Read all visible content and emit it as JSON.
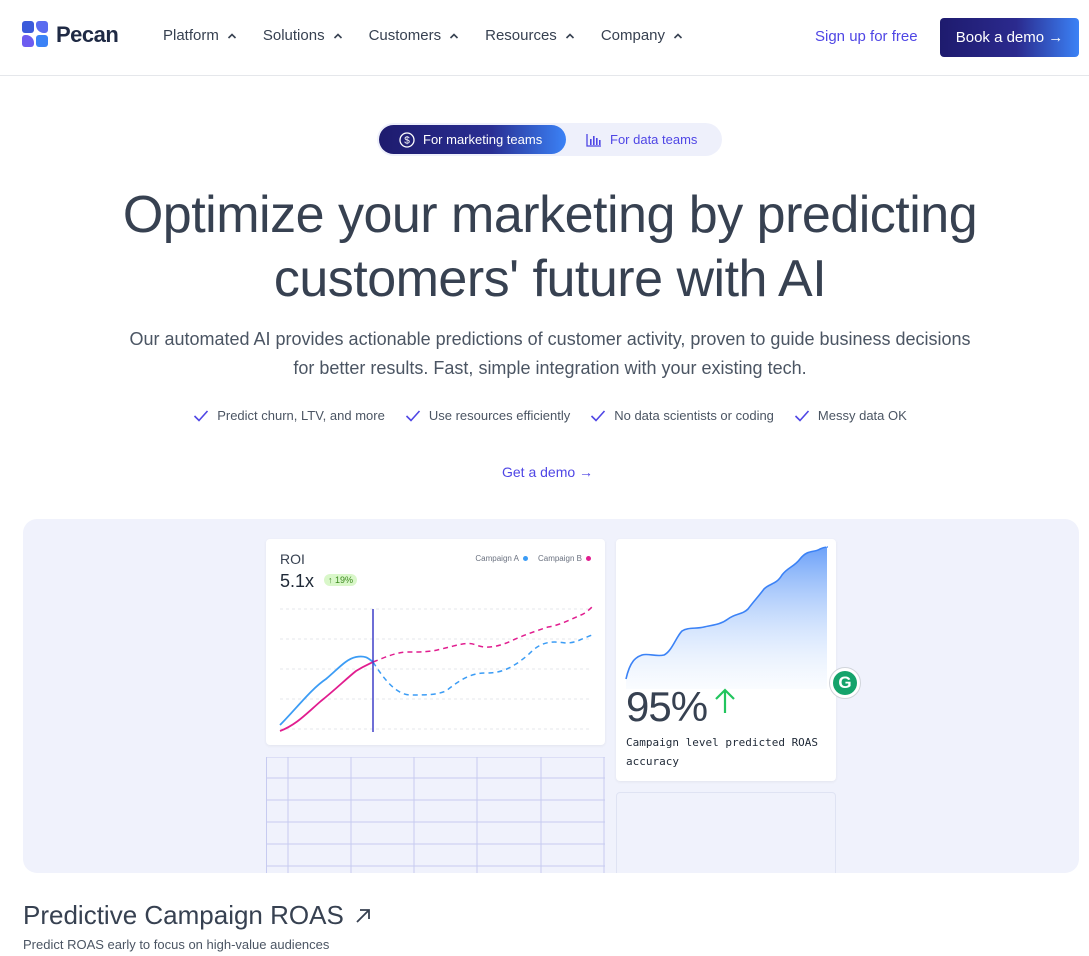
{
  "brand": {
    "name": "Pecan",
    "colors": {
      "accent": "#4f46e5",
      "navy": "#1e1b6e",
      "blue": "#3b82f6",
      "pink": "#e11d8f",
      "green": "#22c55e"
    }
  },
  "nav": {
    "menu": [
      {
        "label": "Platform",
        "icon": "chevron-up-icon"
      },
      {
        "label": "Solutions",
        "icon": "chevron-up-icon"
      },
      {
        "label": "Customers",
        "icon": "chevron-up-icon"
      },
      {
        "label": "Resources",
        "icon": "chevron-up-icon"
      },
      {
        "label": "Company",
        "icon": "chevron-up-icon"
      }
    ],
    "signup": "Sign up for free",
    "book_demo": "Book a demo →"
  },
  "toggle": {
    "active": "For marketing teams",
    "active_icon": "dollar-circle-icon",
    "inactive": "For data teams",
    "inactive_icon": "bar-chart-icon"
  },
  "hero": {
    "title_line1": "Optimize your marketing by predicting",
    "title_line2": "customers' future with AI",
    "subtitle_line1": "Our automated AI provides actionable predictions of customer activity, proven to guide business decisions",
    "subtitle_line2": "for better results. Fast, simple integration with your existing tech.",
    "checks": [
      "Predict churn, LTV, and more",
      "Use resources efficiently",
      "No data scientists or coding",
      "Messy data OK"
    ],
    "cta": "Get a demo →"
  },
  "roi_card": {
    "label": "ROI",
    "value": "5.1x",
    "badge": "↑ 19%",
    "legend": [
      {
        "name": "Campaign A",
        "color": "#3b9cf5"
      },
      {
        "name": "Campaign B",
        "color": "#e11d8f"
      }
    ]
  },
  "accuracy_card": {
    "value": "95%",
    "label": "Campaign level predicted ROAS accuracy"
  },
  "grammarly_badge": "G",
  "feature": {
    "title": "Predictive Campaign ROAS",
    "title_icon": "arrow-up-right-icon",
    "subtitle": "Predict ROAS early to focus on high-value audiences"
  }
}
